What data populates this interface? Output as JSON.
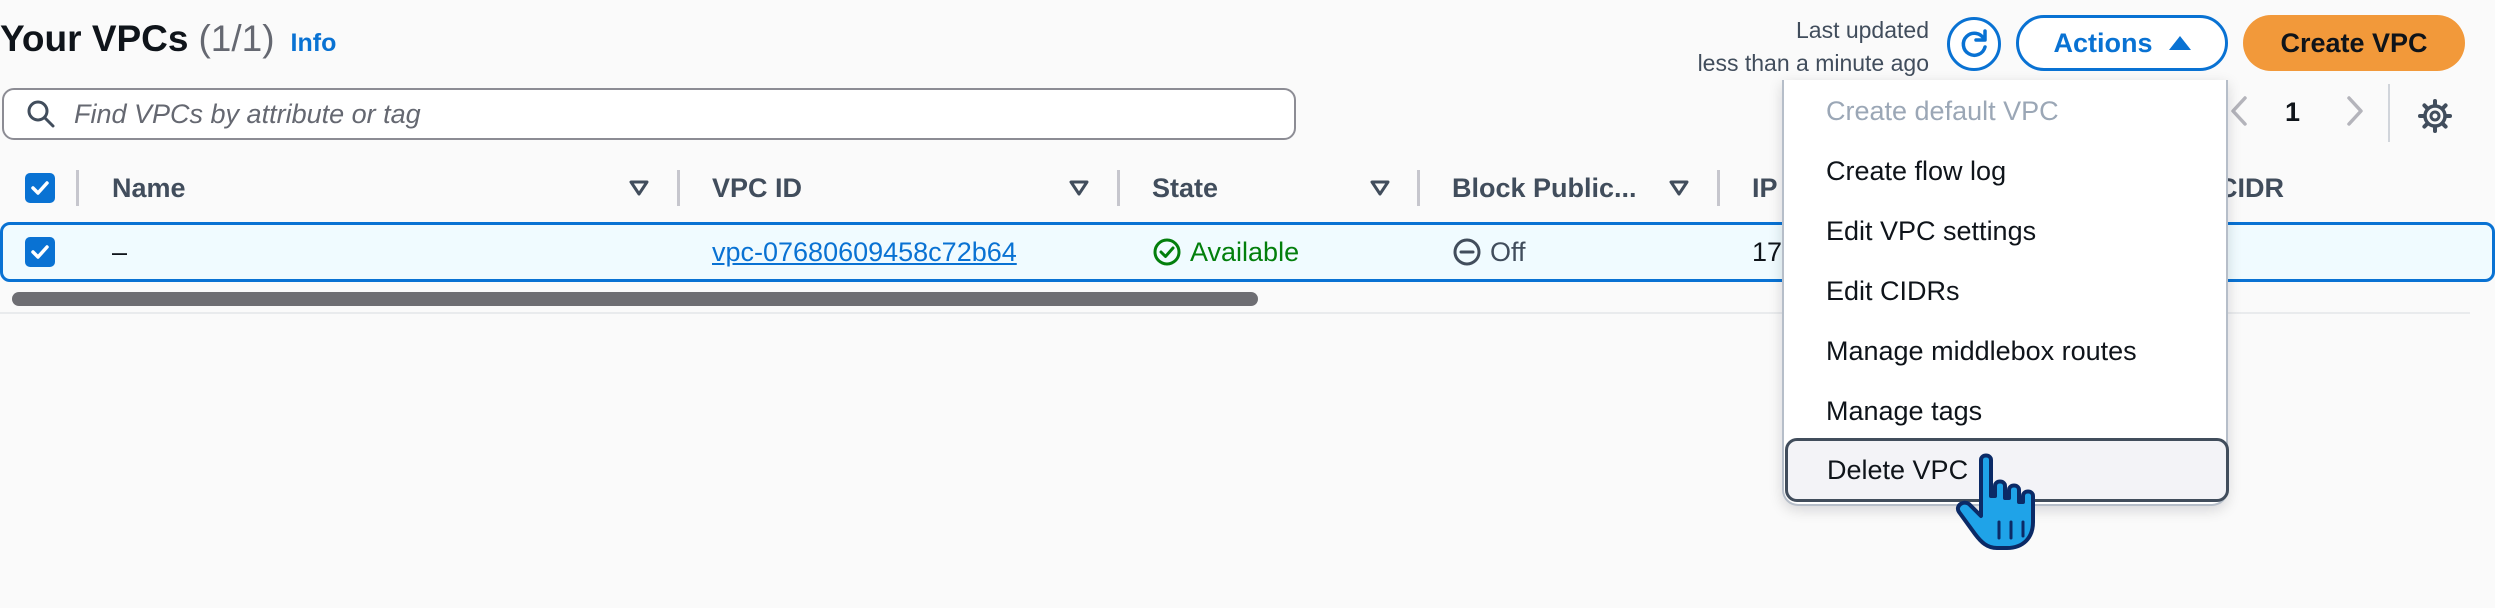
{
  "header": {
    "title": "Your VPCs",
    "count": "(1/1)",
    "info_link": "Info",
    "last_updated_line1": "Last updated",
    "last_updated_line2": "less than a minute ago",
    "actions_label": "Actions",
    "create_label": "Create VPC"
  },
  "search": {
    "placeholder": "Find VPCs by attribute or tag",
    "value": ""
  },
  "pagination": {
    "current_page": "1",
    "prev_icon": "chevron-left-icon",
    "next_icon": "chevron-right-icon"
  },
  "table": {
    "columns": [
      "Name",
      "VPC ID",
      "State",
      "Block Public...",
      "IP",
      "CIDR"
    ],
    "rows": [
      {
        "selected": true,
        "name": "–",
        "vpc_id": "vpc-07680609458c72b64",
        "state": "Available",
        "block_public": "Off",
        "ipv4_partial": "17"
      }
    ]
  },
  "actions_menu": {
    "items": [
      {
        "label": "Create default VPC",
        "disabled": true
      },
      {
        "label": "Create flow log",
        "disabled": false
      },
      {
        "label": "Edit VPC settings",
        "disabled": false
      },
      {
        "label": "Edit CIDRs",
        "disabled": false
      },
      {
        "label": "Manage middlebox routes",
        "disabled": false
      },
      {
        "label": "Manage tags",
        "disabled": false
      },
      {
        "label": "Delete VPC",
        "disabled": false,
        "hovered": true
      }
    ]
  },
  "colors": {
    "accent": "#0972d3",
    "primary_button": "#f2993a",
    "success": "#037f0c",
    "selected_row_bg": "#f0fbff"
  }
}
